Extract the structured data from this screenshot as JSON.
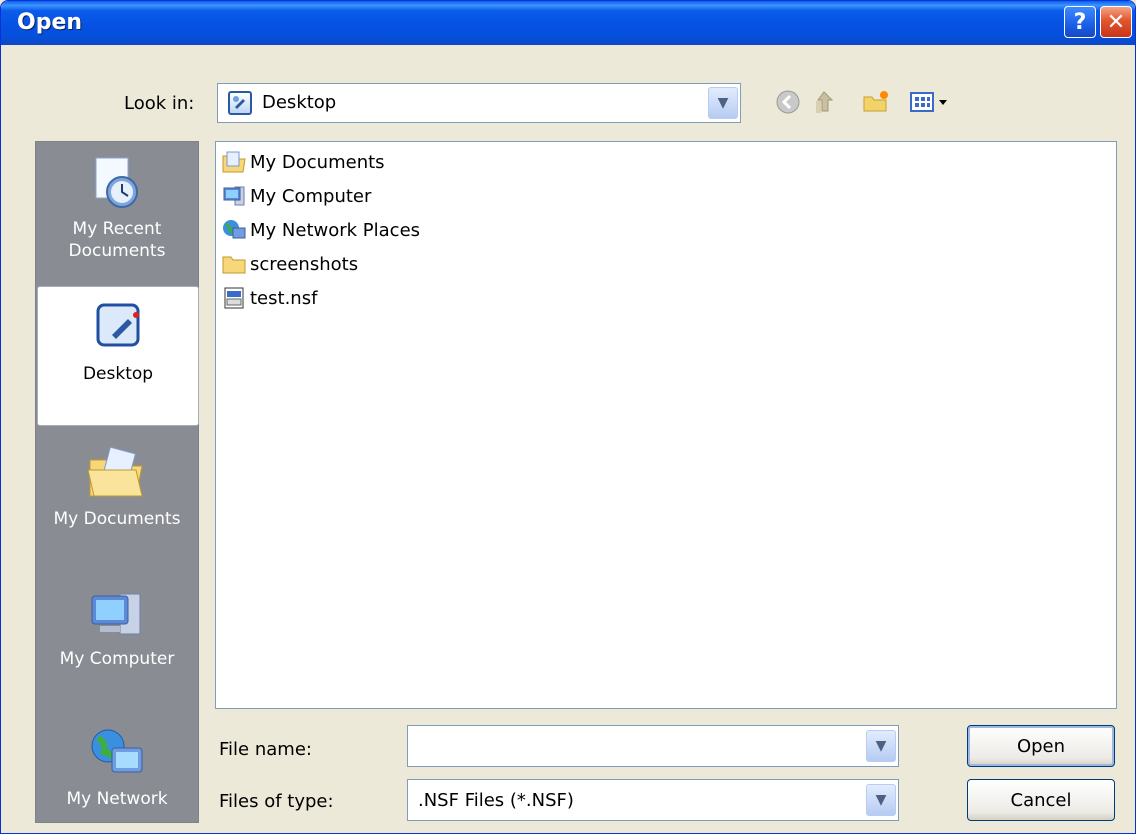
{
  "window": {
    "title": "Open",
    "help_glyph": "?",
    "close_glyph": "✕"
  },
  "lookin": {
    "label": "Look in:",
    "value": "Desktop",
    "icon": "desktop-icon"
  },
  "toolbar": {
    "back_icon": "back-arrow-icon",
    "up_icon": "up-folder-icon",
    "new_folder_icon": "new-folder-icon",
    "views_icon": "views-menu-icon"
  },
  "places": [
    {
      "label": "My Recent Documents",
      "label_line1": "My Recent",
      "label_line2": "Documents",
      "icon": "recent-documents-icon"
    },
    {
      "label": "Desktop",
      "icon": "desktop-icon",
      "selected": true
    },
    {
      "label": "My Documents",
      "icon": "my-documents-icon"
    },
    {
      "label": "My Computer",
      "icon": "my-computer-icon"
    },
    {
      "label": "My Network",
      "icon": "my-network-icon"
    }
  ],
  "files": [
    {
      "name": "My Documents",
      "icon": "my-documents-icon"
    },
    {
      "name": "My Computer",
      "icon": "my-computer-icon"
    },
    {
      "name": "My Network Places",
      "icon": "network-places-icon"
    },
    {
      "name": "screenshots",
      "icon": "folder-icon"
    },
    {
      "name": "test.nsf",
      "icon": "nsf-file-icon"
    }
  ],
  "filename": {
    "label": "File name:",
    "value": ""
  },
  "filetype": {
    "label": "Files of type:",
    "value": ".NSF Files (*.NSF)"
  },
  "buttons": {
    "open": "Open",
    "cancel": "Cancel"
  },
  "colors": {
    "titlebar": "#0751e2",
    "dialog_bg": "#ece9d8",
    "places_bg": "#8a8c94"
  }
}
